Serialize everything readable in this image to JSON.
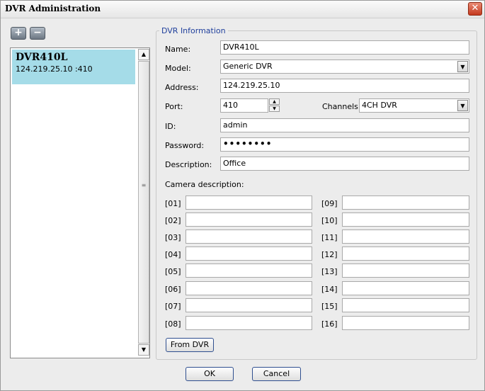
{
  "window": {
    "title": "DVR Administration"
  },
  "toolbar": {
    "add_label": "+",
    "remove_label": "−"
  },
  "dvr_list": {
    "items": [
      {
        "name": "DVR410L",
        "address": "124.219.25.10 :410"
      }
    ]
  },
  "dvr_info": {
    "group_label": "DVR Information",
    "name_label": "Name:",
    "name_value": "DVR410L",
    "model_label": "Model:",
    "model_value": "Generic DVR",
    "address_label": "Address:",
    "address_value": "124.219.25.10",
    "port_label": "Port:",
    "port_value": "410",
    "channels_label": "Channels:",
    "channels_value": "4CH DVR",
    "id_label": "ID:",
    "id_value": "admin",
    "password_label": "Password:",
    "password_value": "••••••••",
    "description_label": "Description:",
    "description_value": "Office",
    "camera_description_label": "Camera description:",
    "cameras": [
      "[01]",
      "[02]",
      "[03]",
      "[04]",
      "[05]",
      "[06]",
      "[07]",
      "[08]",
      "[09]",
      "[10]",
      "[11]",
      "[12]",
      "[13]",
      "[14]",
      "[15]",
      "[16]"
    ],
    "from_dvr_label": "From DVR"
  },
  "dialog": {
    "ok_label": "OK",
    "cancel_label": "Cancel"
  },
  "icons": {
    "close": "close-icon",
    "scroll_up": "scroll-up-arrow-icon",
    "scroll_down": "scroll-down-arrow-icon",
    "dropdown": "dropdown-arrow-icon"
  }
}
